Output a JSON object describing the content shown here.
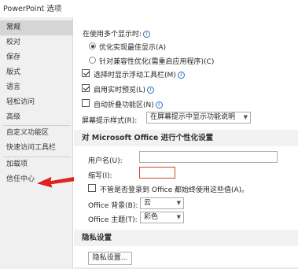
{
  "window": {
    "title": "PowerPoint 选项"
  },
  "sidebar": {
    "items": [
      {
        "label": "常规",
        "active": true
      },
      {
        "label": "校对"
      },
      {
        "label": "保存"
      },
      {
        "label": "版式"
      },
      {
        "label": "语言"
      },
      {
        "label": "轻松访问"
      },
      {
        "label": "高级"
      },
      {
        "label": "自定义功能区"
      },
      {
        "label": "快速访问工具栏"
      },
      {
        "label": "加载项"
      },
      {
        "label": "信任中心"
      }
    ]
  },
  "general": {
    "multi_display_label": "在使用多个显示时:",
    "radio_optimize_appearance": "优化实现最佳显示(A)",
    "radio_optimize_compat": "针对兼容性优化(需重启应用程序)(C)",
    "checkbox_mini_toolbar": "选择时显示浮动工具栏(M)",
    "checkbox_live_preview": "启用实时预览(L)",
    "checkbox_collapse_ribbon": "自动折叠功能区(N)",
    "screentip_label": "屏幕提示样式(R):",
    "screentip_value": "在屏幕提示中显示功能说明"
  },
  "personalize": {
    "header": "对 Microsoft Office 进行个性化设置",
    "username_label": "用户名(U):",
    "username_value": "",
    "initials_label": "缩写(I):",
    "initials_value": "",
    "always_use_label": "不管是否登录到 Office 都始终使用这些值(A)。",
    "background_label": "Office 背景(B):",
    "background_value": "云",
    "theme_label": "Office 主题(T):",
    "theme_value": "彩色"
  },
  "privacy": {
    "header": "隐私设置",
    "button_label": "隐私设置..."
  },
  "colors": {
    "active_nav": "#d5d5d5",
    "sidebar_bg": "#f0f0f0",
    "arrow": "#e8201e",
    "focus_border": "#d24726",
    "info_icon": "#2b6cc4"
  },
  "icons": {
    "info": "info-icon",
    "dropdown": "chevron-down-icon",
    "annotation_arrow": "red-arrow-icon"
  }
}
